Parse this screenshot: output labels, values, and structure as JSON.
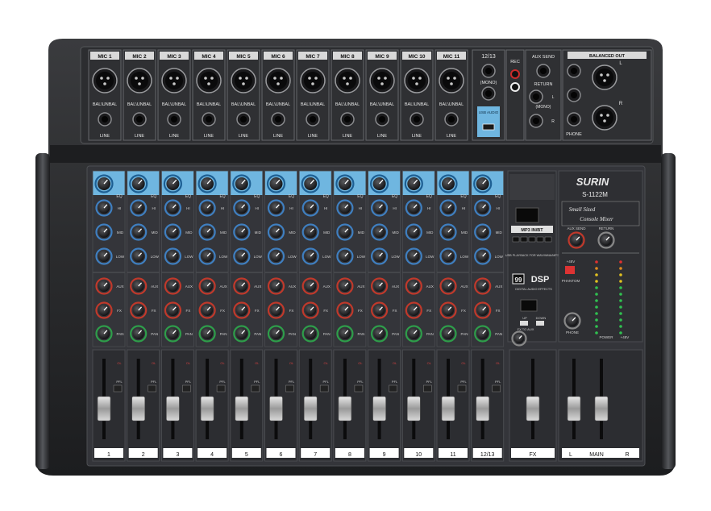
{
  "brand": {
    "name": "SURIN",
    "model": "S-1122M",
    "tagline": [
      "Small Sized",
      "Console Mixer"
    ]
  },
  "top_panel": {
    "mic_labels": [
      "MIC 1",
      "MIC 2",
      "MIC 3",
      "MIC 4",
      "MIC 5",
      "MIC 6",
      "MIC 7",
      "MIC 8",
      "MIC 9",
      "MIC 10",
      "MIC 11"
    ],
    "bal_label": "BAL\\UNBAL",
    "line_label": "LINE",
    "ch1213": "12/13",
    "mono": "(MONO)",
    "rec": "REC",
    "usb_audio": "USB AUDIO",
    "aux_send": "AUX SEND",
    "return": "RETURN",
    "return_mono": "(MONO)",
    "balanced_out": "BALANCED OUT",
    "left": "L",
    "right": "R",
    "phone": "PHONE"
  },
  "channel_strip": {
    "eq_label": "EQ",
    "hi_label": "HI",
    "mid_label": "MID",
    "low_label": "LOW",
    "aux_label": "AUX",
    "fx_label": "FX",
    "pan_label": "PAN",
    "ol_label": "OL",
    "pfl_label": "PFL"
  },
  "center": {
    "mp3": "MP3 IN/BT",
    "usb_playback": "USB PLAYBACK FOR WAV/WMA/MP3",
    "dsp_num": "99",
    "dsp": "DSP",
    "dsp_sub": "DIGITAL AUDIO EFFECTS",
    "fx_to_aux": "FX TO AUX",
    "up": "UP",
    "down": "DOWN"
  },
  "right_panel": {
    "aux_send": "AUX SEND",
    "return": "RETURN",
    "plus48v": "+48V",
    "phantom": "PHANTOM",
    "phone": "PHONE",
    "power": "POWER",
    "power48": "+48V"
  },
  "fader_labels": [
    "1",
    "2",
    "3",
    "4",
    "5",
    "6",
    "7",
    "8",
    "9",
    "10",
    "11",
    "12/13"
  ],
  "fx_label": "FX",
  "main_labels": {
    "l": "L",
    "main": "MAIN",
    "r": "R"
  },
  "colors": {
    "body": "#2a2b2d",
    "panel": "#3b3c3f",
    "blue": "#6fb6e0",
    "knob_blue": "#3f7fc0",
    "knob_red": "#c0392b",
    "knob_green": "#2e9e4a"
  }
}
